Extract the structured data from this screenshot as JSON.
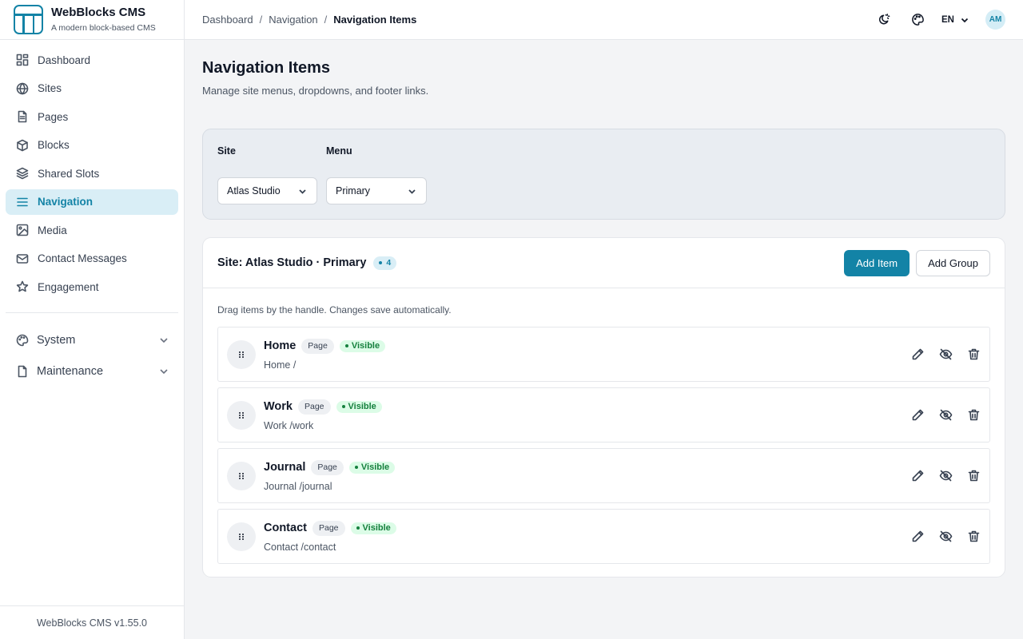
{
  "app": {
    "name": "WebBlocks CMS",
    "tagline": "A modern block-based CMS",
    "version": "WebBlocks CMS v1.55.0",
    "accent": "#1383a6"
  },
  "sidebar": {
    "items": [
      {
        "label": "Dashboard",
        "icon": "dashboard-icon"
      },
      {
        "label": "Sites",
        "icon": "globe-icon"
      },
      {
        "label": "Pages",
        "icon": "document-icon"
      },
      {
        "label": "Blocks",
        "icon": "cube-icon"
      },
      {
        "label": "Shared Slots",
        "icon": "layers-icon"
      },
      {
        "label": "Navigation",
        "icon": "menu-icon",
        "active": true
      },
      {
        "label": "Media",
        "icon": "image-icon"
      },
      {
        "label": "Contact Messages",
        "icon": "mail-icon"
      },
      {
        "label": "Engagement",
        "icon": "star-icon"
      }
    ],
    "groups": [
      {
        "label": "System",
        "icon": "palette-icon"
      },
      {
        "label": "Maintenance",
        "icon": "file-icon"
      }
    ]
  },
  "topbar": {
    "breadcrumb": [
      "Dashboard",
      "Navigation",
      "Navigation Items"
    ],
    "breadcrumb_sep": "/",
    "language": "EN",
    "avatar_initials": "AM"
  },
  "page": {
    "title": "Navigation Items",
    "subtitle": "Manage site menus, dropdowns, and footer links."
  },
  "filters": {
    "site_label": "Site",
    "site_value": "Atlas Studio",
    "menu_label": "Menu",
    "menu_value": "Primary"
  },
  "list": {
    "title": "Site: Atlas Studio · Primary",
    "count": "4",
    "add_item_label": "Add Item",
    "add_group_label": "Add Group",
    "hint": "Drag items by the handle. Changes save automatically.",
    "items": [
      {
        "name": "Home",
        "type": "Page",
        "status": "Visible",
        "path": "Home /"
      },
      {
        "name": "Work",
        "type": "Page",
        "status": "Visible",
        "path": "Work /work"
      },
      {
        "name": "Journal",
        "type": "Page",
        "status": "Visible",
        "path": "Journal /journal"
      },
      {
        "name": "Contact",
        "type": "Page",
        "status": "Visible",
        "path": "Contact /contact"
      }
    ]
  }
}
